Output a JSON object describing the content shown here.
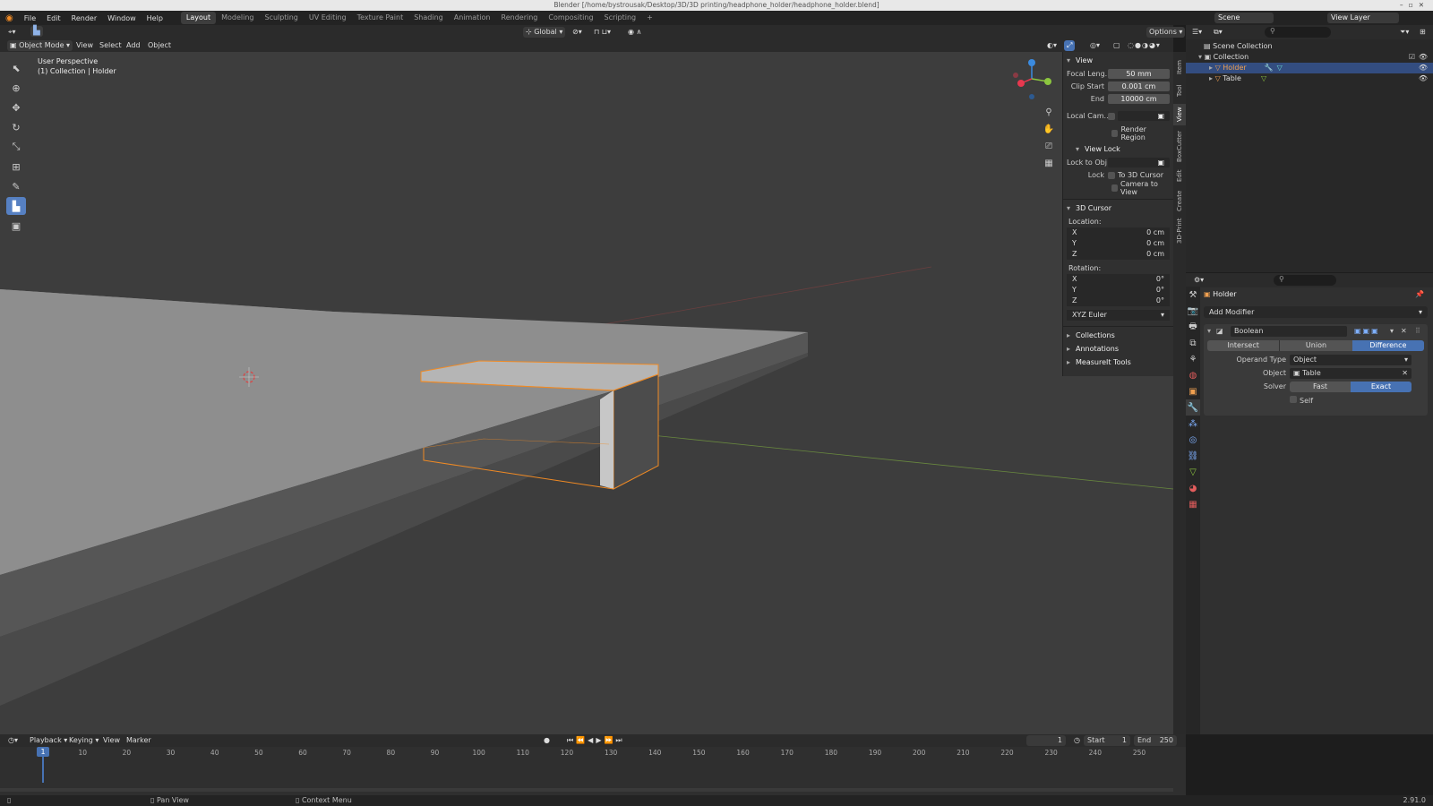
{
  "title_bar": "Blender [/home/bystrousak/Desktop/3D/3D printing/headphone_holder/headphone_holder.blend]",
  "menus": [
    "File",
    "Edit",
    "Render",
    "Window",
    "Help"
  ],
  "workspaces": [
    "Layout",
    "Modeling",
    "Sculpting",
    "UV Editing",
    "Texture Paint",
    "Shading",
    "Animation",
    "Rendering",
    "Compositing",
    "Scripting"
  ],
  "active_workspace": "Layout",
  "scene": "Scene",
  "view_layer": "View Layer",
  "viewport": {
    "mode": "Object Mode",
    "menu": [
      "View",
      "Select",
      "Add",
      "Object"
    ],
    "transform_orientation": "Global",
    "options": "Options",
    "perspective_label": "User Perspective",
    "collection_label": "(1) Collection | Holder"
  },
  "npanel": {
    "view_header": "View",
    "focal_length_label": "Focal Leng...",
    "focal_length": "50 mm",
    "clip_start_label": "Clip Start",
    "clip_start": "0.001 cm",
    "clip_end_label": "End",
    "clip_end": "10000 cm",
    "local_camera_label": "Local Cam...",
    "render_region": "Render Region",
    "view_lock_header": "View Lock",
    "lock_to_obj_label": "Lock to Obj",
    "lock_label": "Lock",
    "to_3d_cursor": "To 3D Cursor",
    "camera_to_view": "Camera to View",
    "cursor_header": "3D Cursor",
    "location_label": "Location:",
    "loc_x": "0 cm",
    "loc_y": "0 cm",
    "loc_z": "0 cm",
    "rotation_label": "Rotation:",
    "rot_x": "0°",
    "rot_y": "0°",
    "rot_z": "0°",
    "rotation_mode": "XYZ Euler",
    "collections": "Collections",
    "annotations": "Annotations",
    "measureit": "MeasureIt Tools"
  },
  "side_tabs": [
    "Item",
    "Tool",
    "View",
    "BoxCutter",
    "Edit",
    "Create",
    "3D-Print"
  ],
  "active_side_tab": "View",
  "outliner": {
    "scene_collection": "Scene Collection",
    "collection": "Collection",
    "items": [
      {
        "name": "Holder",
        "selected": true
      },
      {
        "name": "Table",
        "selected": false
      }
    ]
  },
  "properties": {
    "object_name": "Holder",
    "add_modifier": "Add Modifier",
    "modifier_name": "Boolean",
    "operations": [
      "Intersect",
      "Union",
      "Difference"
    ],
    "active_operation": "Difference",
    "operand_type_label": "Operand Type",
    "operand_type": "Object",
    "object_label": "Object",
    "object_value": "Table",
    "solver_label": "Solver",
    "solvers": [
      "Fast",
      "Exact"
    ],
    "active_solver": "Exact",
    "self_label": "Self"
  },
  "timeline": {
    "menus": [
      "Playback",
      "Keying",
      "View",
      "Marker"
    ],
    "current_frame": "1",
    "start_label": "Start",
    "start": "1",
    "end_label": "End",
    "end": "250",
    "frame_ticks": [
      "10",
      "20",
      "30",
      "40",
      "50",
      "60",
      "70",
      "80",
      "90",
      "100",
      "110",
      "120",
      "130",
      "140",
      "150",
      "160",
      "170",
      "180",
      "190",
      "200",
      "210",
      "220",
      "230",
      "240",
      "250"
    ],
    "playhead": "1"
  },
  "status": {
    "pan": "Pan View",
    "context": "Context Menu",
    "version": "2.91.0"
  },
  "colors": {
    "selection_outline": "#f08a24",
    "accent": "#4772b3",
    "x_axis": "#e8384f",
    "y_axis": "#8cc63f",
    "z_axis": "#3b8be0"
  }
}
